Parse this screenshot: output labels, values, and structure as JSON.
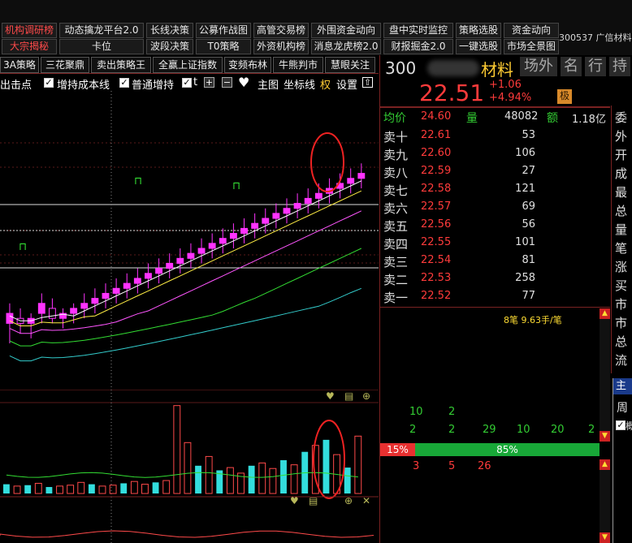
{
  "menu": {
    "row1": [
      "机构调研榜",
      "动态擒龙平台2.0",
      "长线决策",
      "公募作战图",
      "高管交易榜",
      "外围资金动向",
      "盘中实时监控",
      "策略选股",
      "资金动向"
    ],
    "row2": [
      "大宗揭秘",
      "卡位",
      "波段决策",
      "T0策略",
      "外资机构榜",
      "消息龙虎榜2.0",
      "财报掘金2.0",
      "一键选股",
      "市场全景图"
    ],
    "stock_label": "300537 广信材料"
  },
  "tabs": [
    "3A策略",
    "三花聚鼎",
    "卖出策略王",
    "全赢上证指数",
    "变频布林",
    "牛熊判市",
    "慧眼关注"
  ],
  "toolbar": {
    "item1": "出击点",
    "item2": "增持成本线",
    "item3": "普通增持",
    "item4": "t",
    "check_mark": "✓",
    "plus": "+",
    "minus": "−",
    "heart": "♥",
    "main_label": "主图",
    "coord_label": "坐标线",
    "quan": "权",
    "settings": "设置",
    "up": "⇧"
  },
  "quote": {
    "code": "300",
    "name": "材料",
    "tags": [
      "场外",
      "名",
      "行",
      "持"
    ],
    "price": "22.51",
    "change": "+1.06",
    "change_pct": "+4.94%",
    "ji": "极",
    "avg_label": "均价",
    "avg_value": "24.60",
    "vol_label": "量",
    "vol_value": "48082",
    "amt_label": "额",
    "amt_value": "1.18亿",
    "asks": [
      {
        "label": "卖十",
        "price": "22.61",
        "vol": "53"
      },
      {
        "label": "卖九",
        "price": "22.60",
        "vol": "106"
      },
      {
        "label": "卖八",
        "price": "22.59",
        "vol": "27"
      },
      {
        "label": "卖七",
        "price": "22.58",
        "vol": "121"
      },
      {
        "label": "卖六",
        "price": "22.57",
        "vol": "69"
      },
      {
        "label": "卖五",
        "price": "22.56",
        "vol": "56"
      },
      {
        "label": "卖四",
        "price": "22.55",
        "vol": "101"
      },
      {
        "label": "卖三",
        "price": "22.54",
        "vol": "81"
      },
      {
        "label": "卖二",
        "price": "22.53",
        "vol": "258"
      },
      {
        "label": "卖一",
        "price": "22.52",
        "vol": "77"
      }
    ],
    "right_col": [
      "委",
      "外",
      "开",
      "成",
      "最",
      "总",
      "量",
      "笔",
      "涨",
      "买",
      "市",
      "市",
      "总",
      "流"
    ],
    "trade_info": "8笔 9.63手/笔",
    "trade_rows": [
      [
        "10",
        "2",
        "",
        "",
        "",
        ""
      ],
      [
        "2",
        "2",
        "29",
        "10",
        "20",
        "2"
      ]
    ],
    "ratio_buy": "15%",
    "ratio_sell": "85%",
    "ratio_buy_value": 0.15,
    "bottom_row": [
      "3",
      "5",
      "26"
    ],
    "panel2_title": "主",
    "panel2_char": "周",
    "panel2_check": "✓",
    "panel2_char2": "概"
  },
  "icons": {
    "heart": "♥",
    "calc": "▤",
    "zoom": "⊕",
    "close": "✕",
    "lock": "🔓",
    "up_arrow": "▲",
    "down_arrow": "▼"
  },
  "chart_data": {
    "type": "candlestick",
    "candles": [
      {
        "o": 3.0,
        "h": 3.4,
        "l": 2.6,
        "c": 3.2
      },
      {
        "o": 3.1,
        "h": 3.3,
        "l": 2.8,
        "c": 3.0
      },
      {
        "o": 3.0,
        "h": 3.2,
        "l": 2.7,
        "c": 3.1
      },
      {
        "o": 3.2,
        "h": 3.6,
        "l": 3.0,
        "c": 3.4
      },
      {
        "o": 3.3,
        "h": 3.5,
        "l": 3.0,
        "c": 3.1
      },
      {
        "o": 3.1,
        "h": 3.3,
        "l": 2.9,
        "c": 3.2
      },
      {
        "o": 3.2,
        "h": 3.4,
        "l": 3.0,
        "c": 3.3
      },
      {
        "o": 3.3,
        "h": 3.6,
        "l": 3.1,
        "c": 3.4
      },
      {
        "o": 3.4,
        "h": 3.7,
        "l": 3.2,
        "c": 3.5
      },
      {
        "o": 3.5,
        "h": 3.8,
        "l": 3.3,
        "c": 3.6
      },
      {
        "o": 3.6,
        "h": 3.9,
        "l": 3.4,
        "c": 3.7
      },
      {
        "o": 3.7,
        "h": 4.0,
        "l": 3.5,
        "c": 3.8
      },
      {
        "o": 3.8,
        "h": 4.1,
        "l": 3.6,
        "c": 3.9
      },
      {
        "o": 3.9,
        "h": 4.2,
        "l": 3.7,
        "c": 4.0
      },
      {
        "o": 4.0,
        "h": 4.3,
        "l": 3.8,
        "c": 4.1
      },
      {
        "o": 4.1,
        "h": 4.4,
        "l": 3.9,
        "c": 4.2
      },
      {
        "o": 4.2,
        "h": 4.5,
        "l": 4.0,
        "c": 4.3
      },
      {
        "o": 4.3,
        "h": 4.6,
        "l": 4.1,
        "c": 4.4
      },
      {
        "o": 4.4,
        "h": 4.7,
        "l": 4.2,
        "c": 4.5
      },
      {
        "o": 4.5,
        "h": 4.8,
        "l": 4.3,
        "c": 4.6
      },
      {
        "o": 4.6,
        "h": 4.9,
        "l": 4.4,
        "c": 4.7
      },
      {
        "o": 4.7,
        "h": 5.0,
        "l": 4.5,
        "c": 4.8
      },
      {
        "o": 4.8,
        "h": 5.1,
        "l": 4.6,
        "c": 4.9
      },
      {
        "o": 4.9,
        "h": 5.2,
        "l": 4.7,
        "c": 5.0
      },
      {
        "o": 5.0,
        "h": 5.3,
        "l": 4.8,
        "c": 5.1
      },
      {
        "o": 5.1,
        "h": 5.4,
        "l": 4.9,
        "c": 5.2
      },
      {
        "o": 5.2,
        "h": 5.5,
        "l": 5.0,
        "c": 5.3
      },
      {
        "o": 5.3,
        "h": 5.6,
        "l": 5.1,
        "c": 5.4
      },
      {
        "o": 5.4,
        "h": 5.7,
        "l": 5.2,
        "c": 5.5
      },
      {
        "o": 5.5,
        "h": 5.8,
        "l": 5.3,
        "c": 5.6
      },
      {
        "o": 5.6,
        "h": 5.9,
        "l": 5.4,
        "c": 5.7
      },
      {
        "o": 5.7,
        "h": 6.0,
        "l": 5.5,
        "c": 5.8
      },
      {
        "o": 5.8,
        "h": 6.1,
        "l": 5.6,
        "c": 5.9
      },
      {
        "o": 5.9,
        "h": 6.2,
        "l": 5.7,
        "c": 6.0
      }
    ],
    "volume": [
      {
        "v": 0.1,
        "up": false
      },
      {
        "v": 0.08,
        "up": true
      },
      {
        "v": 0.09,
        "up": false
      },
      {
        "v": 0.11,
        "up": true
      },
      {
        "v": 0.07,
        "up": false
      },
      {
        "v": 0.08,
        "up": true
      },
      {
        "v": 0.09,
        "up": true
      },
      {
        "v": 0.12,
        "up": true
      },
      {
        "v": 0.1,
        "up": false
      },
      {
        "v": 0.08,
        "up": true
      },
      {
        "v": 0.09,
        "up": true
      },
      {
        "v": 0.11,
        "up": false
      },
      {
        "v": 0.13,
        "up": true
      },
      {
        "v": 0.1,
        "up": true
      },
      {
        "v": 0.12,
        "up": false
      },
      {
        "v": 0.14,
        "up": true
      },
      {
        "v": 0.95,
        "up": true
      },
      {
        "v": 0.55,
        "up": true
      },
      {
        "v": 0.3,
        "up": false
      },
      {
        "v": 0.4,
        "up": true
      },
      {
        "v": 0.25,
        "up": false
      },
      {
        "v": 0.28,
        "up": true
      },
      {
        "v": 0.22,
        "up": true
      },
      {
        "v": 0.3,
        "up": false
      },
      {
        "v": 0.33,
        "up": true
      },
      {
        "v": 0.27,
        "up": true
      },
      {
        "v": 0.36,
        "up": false
      },
      {
        "v": 0.31,
        "up": true
      },
      {
        "v": 0.45,
        "up": false
      },
      {
        "v": 0.52,
        "up": true
      },
      {
        "v": 0.58,
        "up": false
      },
      {
        "v": 0.42,
        "up": true
      },
      {
        "v": 0.28,
        "up": false
      },
      {
        "v": 0.62,
        "up": true
      }
    ],
    "grid": true
  }
}
